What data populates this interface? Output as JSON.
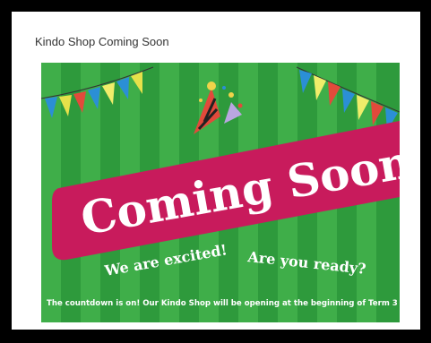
{
  "post": {
    "title": "Kindo Shop Coming Soon"
  },
  "banner": {
    "headline": "Coming Soon",
    "excited": "We are excited!",
    "ready": "Are you ready?",
    "message": "The countdown is on! Our Kindo Shop will be opening at the beginning of Term 3",
    "colors": {
      "stripe_light": "#3fae49",
      "stripe_dark": "#2e9a3c",
      "ribbon": "#c81b5c",
      "text": "#ffffff"
    },
    "icons": [
      "bunting-left",
      "bunting-right",
      "party-hat-icon"
    ]
  }
}
